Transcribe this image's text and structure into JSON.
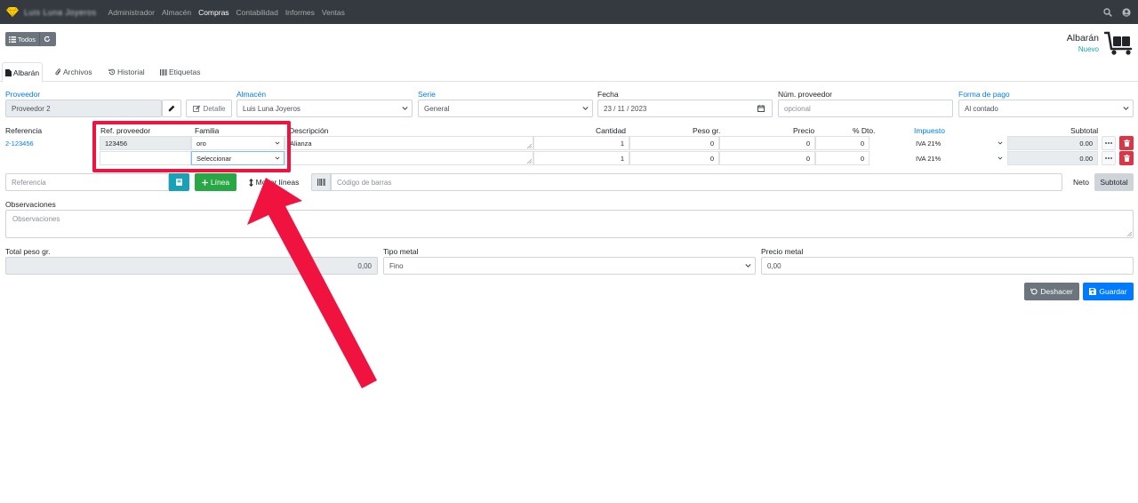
{
  "navbar": {
    "brand": "Luis Luna Joyeros",
    "items": [
      {
        "label": "Administrador",
        "active": false
      },
      {
        "label": "Almacén",
        "active": false
      },
      {
        "label": "Compras",
        "active": true
      },
      {
        "label": "Contabilidad",
        "active": false
      },
      {
        "label": "Informes",
        "active": false
      },
      {
        "label": "Ventas",
        "active": false
      }
    ]
  },
  "toolbar": {
    "todos_label": "Todos"
  },
  "header": {
    "title": "Albarán",
    "subtitle": "Nuevo"
  },
  "tabs": [
    {
      "label": "Albarán",
      "icon": "file-icon",
      "active": true
    },
    {
      "label": "Archivos",
      "icon": "paperclip-icon",
      "active": false
    },
    {
      "label": "Historial",
      "icon": "history-icon",
      "active": false
    },
    {
      "label": "Etiquetas",
      "icon": "barcode-icon",
      "active": false
    }
  ],
  "form": {
    "proveedor_label": "Proveedor",
    "proveedor_value": "Proveedor 2",
    "detalle_label": "Detalle",
    "almacen_label": "Almacén",
    "almacen_value": "Luis Luna Joyeros",
    "serie_label": "Serie",
    "serie_value": "General",
    "fecha_label": "Fecha",
    "fecha_value": "23 / 11 / 2023",
    "num_proveedor_label": "Núm. proveedor",
    "num_proveedor_placeholder": "opcional",
    "forma_pago_label": "Forma de pago",
    "forma_pago_value": "Al contado"
  },
  "lines": {
    "headers": {
      "referencia": "Referencia",
      "ref_proveedor": "Ref. proveedor",
      "familia": "Familia",
      "descripcion": "Descripción",
      "cantidad": "Cantidad",
      "peso": "Peso gr.",
      "precio": "Precio",
      "dto": "% Dto.",
      "impuesto": "Impuesto",
      "subtotal": "Subtotal"
    },
    "rows": [
      {
        "referencia": "2-123456",
        "ref_proveedor": "123456",
        "familia": "oro",
        "descripcion": "Alianza",
        "cantidad": "1",
        "peso": "0",
        "precio": "0",
        "dto": "0",
        "impuesto": "IVA 21%",
        "subtotal": "0.00"
      },
      {
        "referencia": "",
        "ref_proveedor": "",
        "familia": "Seleccionar",
        "descripcion": "",
        "cantidad": "1",
        "peso": "0",
        "precio": "0",
        "dto": "0",
        "impuesto": "IVA 21%",
        "subtotal": "0.00"
      }
    ]
  },
  "actions_bar": {
    "referencia_placeholder": "Referencia",
    "linea_label": "Línea",
    "mover_lineas_label": "Mover líneas",
    "codigo_barras_placeholder": "Código de barras",
    "neto_label": "Neto",
    "subtotal_label": "Subtotal"
  },
  "observaciones": {
    "label": "Observaciones",
    "placeholder": "Observaciones"
  },
  "totals": {
    "total_peso_label": "Total peso gr.",
    "total_peso_value": "0,00",
    "tipo_metal_label": "Tipo metal",
    "tipo_metal_value": "Fino",
    "precio_metal_label": "Precio metal",
    "precio_metal_value": "0,00"
  },
  "footer": {
    "deshacer_label": "Deshacer",
    "guardar_label": "Guardar"
  },
  "colors": {
    "navbar": "#343a40",
    "primary": "#007bff",
    "info": "#17a2b8",
    "success": "#28a745",
    "danger": "#dc3545",
    "secondary": "#6c757d",
    "annotation": "#f0123f"
  }
}
